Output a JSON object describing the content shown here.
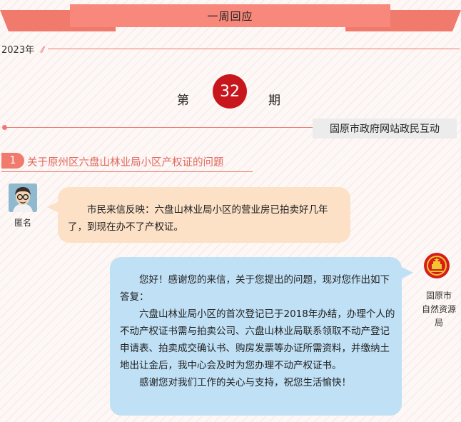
{
  "header": {
    "title": "一周回应"
  },
  "year": "2023年",
  "issue": {
    "prefix": "第",
    "number": "32",
    "suffix": "期"
  },
  "source": "固原市政府网站政民互动",
  "question": {
    "index": "1",
    "title": "关于原州区六盘山林业局小区产权证的问题"
  },
  "citizen": {
    "name": "匿名",
    "message": "市民来信反映：六盘山林业局小区的营业房已拍卖好几年了，到现在办不了产权证。"
  },
  "reply": {
    "agency": [
      "固原市",
      "自然资源",
      "局"
    ],
    "paragraphs": [
      "您好！感谢您的来信，关于您提出的问题，现对您作出如下答复：",
      "六盘山林业局小区的首次登记已于2018年办结，办理个人的不动产权证书需与拍卖公司、六盘山林业局联系领取不动产登记申请表、拍卖成交确认书、购房发票等办证所需资料，并缴纳土地出让金后，我中心会及时为您办理不动产权证书。",
      "感谢您对我们工作的关心与支持，祝您生活愉快！"
    ]
  },
  "colors": {
    "accent": "#f07a6c",
    "issue_circle": "#c8161d",
    "citizen_bubble": "#fce1c6",
    "reply_bubble": "#bfe0f5"
  }
}
